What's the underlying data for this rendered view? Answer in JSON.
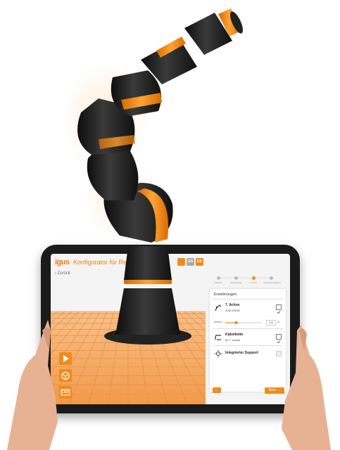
{
  "app": {
    "logo": "igus",
    "title": "Konfigurator für Re",
    "back_link": "‹ Zurück",
    "languages": [
      "",
      "EN",
      "DE"
    ]
  },
  "steps": [
    "Gelenke",
    "Ausrichtung",
    "Zubehör",
    "Vorschau & Export"
  ],
  "panel": {
    "title": "Erweiterungen",
    "items": [
      {
        "name": "7. Achse",
        "sub": "ZLW-2020S",
        "checked": true
      },
      {
        "name": "Kabelkette",
        "sub": "für 7. Achse",
        "checked": true
      },
      {
        "name": "Integrierter Support",
        "sub": "",
        "checked": false
      }
    ],
    "slider": {
      "label": "Achse 1",
      "value": "1.4",
      "unit": "m",
      "fraction": 0.3
    }
  },
  "nav": {
    "back": "←",
    "next": "Next →"
  },
  "sidebar": {
    "cad_label": "CAD"
  },
  "colors": {
    "accent": "#f08a1a",
    "robot_body": "#1c1c1c",
    "robot_ring": "#f7931e"
  },
  "icons": [
    "play-icon",
    "cube-icon",
    "cad-icon",
    "robot-arm-icon",
    "cable-chain-icon",
    "support-icon",
    "checkbox-icon",
    "arrow-left-icon"
  ]
}
